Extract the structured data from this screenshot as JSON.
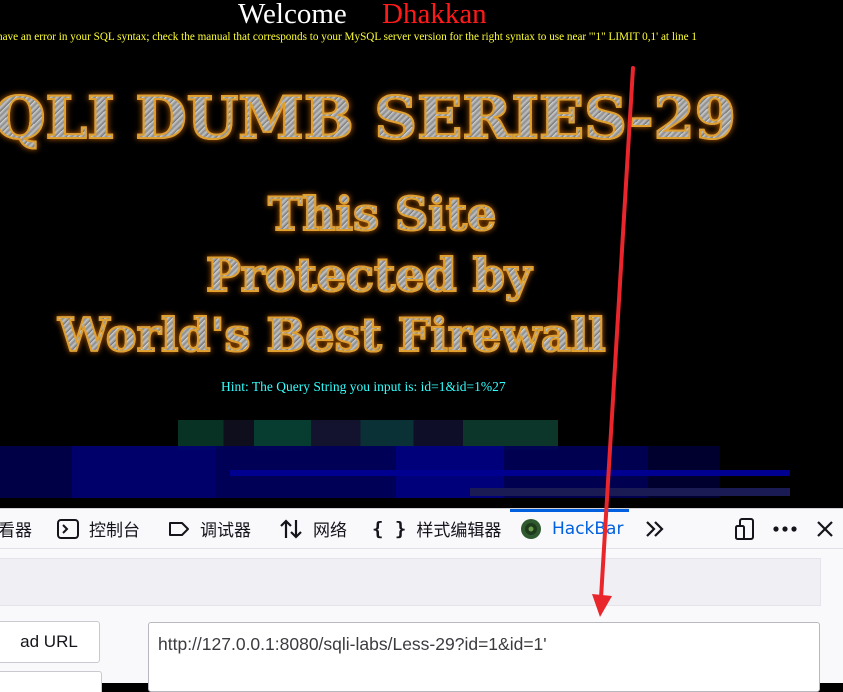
{
  "page": {
    "welcome_label": "Welcome",
    "user_name": "Dhakkan",
    "sql_error": "have an error in your SQL syntax; check the manual that corresponds to your MySQL server version for the right syntax to use near '\"1\" LIMIT 0,1' at line 1",
    "title": "QLI DUMB SERIES-29",
    "banner_line1": "This Site",
    "banner_line2": "Protected by",
    "banner_line3": "World's Best Firewall",
    "hint": "Hint: The Query String you input is: id=1&id=1%27"
  },
  "devtools": {
    "tabs": [
      {
        "label": "看器",
        "icon": "inspector-icon"
      },
      {
        "label": "控制台",
        "icon": "console-icon"
      },
      {
        "label": "调试器",
        "icon": "debugger-icon"
      },
      {
        "label": "网络",
        "icon": "network-icon"
      },
      {
        "label": "样式编辑器",
        "icon": "style-editor-icon"
      },
      {
        "label": "HackBar",
        "icon": "hackbar-icon",
        "active": true
      }
    ],
    "load_url_label": "ad URL",
    "url_value": "http://127.0.0.1:8080/sqli-labs/Less-29?id=1&id=1'"
  },
  "colors": {
    "accent": "#0060df",
    "error_text": "#ffff33",
    "hint_text": "#33ffff",
    "user_name": "#ff1a1a",
    "annotation_arrow": "#e8262b"
  }
}
